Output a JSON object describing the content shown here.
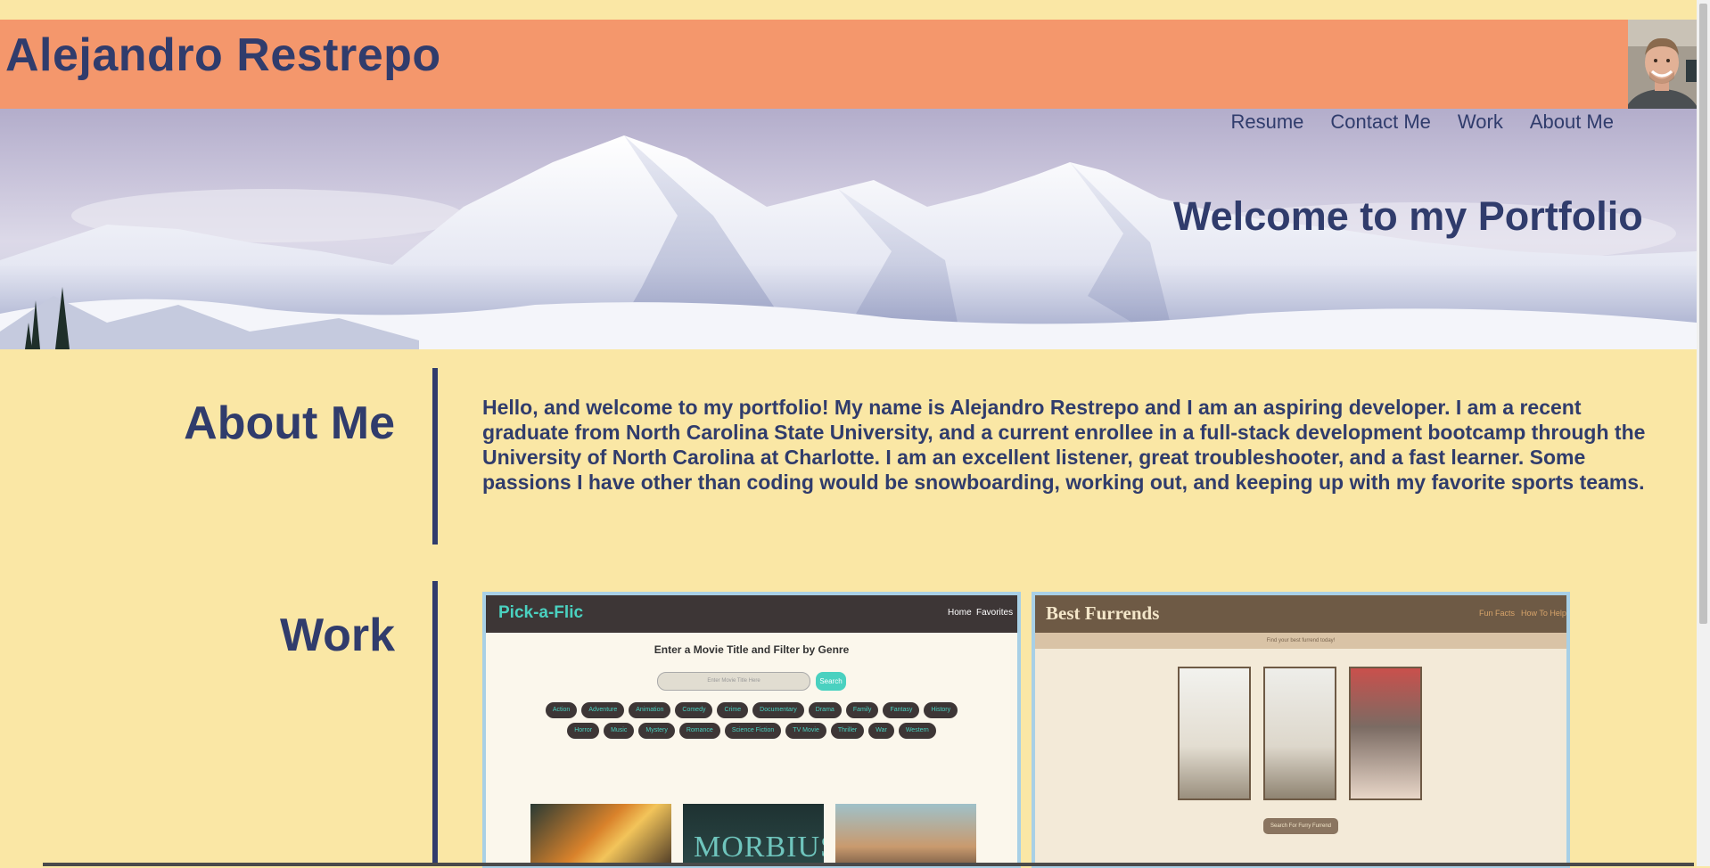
{
  "header": {
    "title": "Alejandro Restrepo"
  },
  "nav": {
    "links": [
      "Resume",
      "Contact Me",
      "Work",
      "About Me"
    ]
  },
  "hero": {
    "heading": "Welcome to my Portfolio"
  },
  "about": {
    "title": "About Me",
    "text": "Hello, and welcome to my portfolio! My name is Alejandro Restrepo and I am an aspiring developer. I am a recent graduate from North Carolina State University, and a current enrollee in a full-stack development bootcamp through the University of North Carolina at Charlotte. I am an excellent listener, great troubleshooter, and a fast learner. Some passions I have other than coding would be snowboarding, working out, and keeping up with my favorite sports teams."
  },
  "work": {
    "title": "Work",
    "projects": [
      {
        "name": "Pick-a-Flic",
        "nav": [
          "Home",
          "Favorites"
        ],
        "heading": "Enter a Movie Title and Filter by Genre",
        "placeholder": "Enter Movie Title Here",
        "button": "Search",
        "genres": [
          "Action",
          "Adventure",
          "Animation",
          "Comedy",
          "Crime",
          "Documentary",
          "Drama",
          "Family",
          "Fantasy",
          "History",
          "Horror",
          "Music",
          "Mystery",
          "Romance",
          "Science Fiction",
          "TV Movie",
          "Thriller",
          "War",
          "Western"
        ],
        "poster_text": "MORBIUS"
      },
      {
        "name": "Best Furrends",
        "nav": [
          "Fun Facts",
          "How To Help"
        ],
        "tagline": "Find your best furrend today!",
        "button": "Search For Furry Furrend"
      }
    ]
  },
  "colors": {
    "background": "#fae7a5",
    "header": "#f4976c",
    "text": "#303c6c",
    "card_border": "#a8d0e6"
  }
}
